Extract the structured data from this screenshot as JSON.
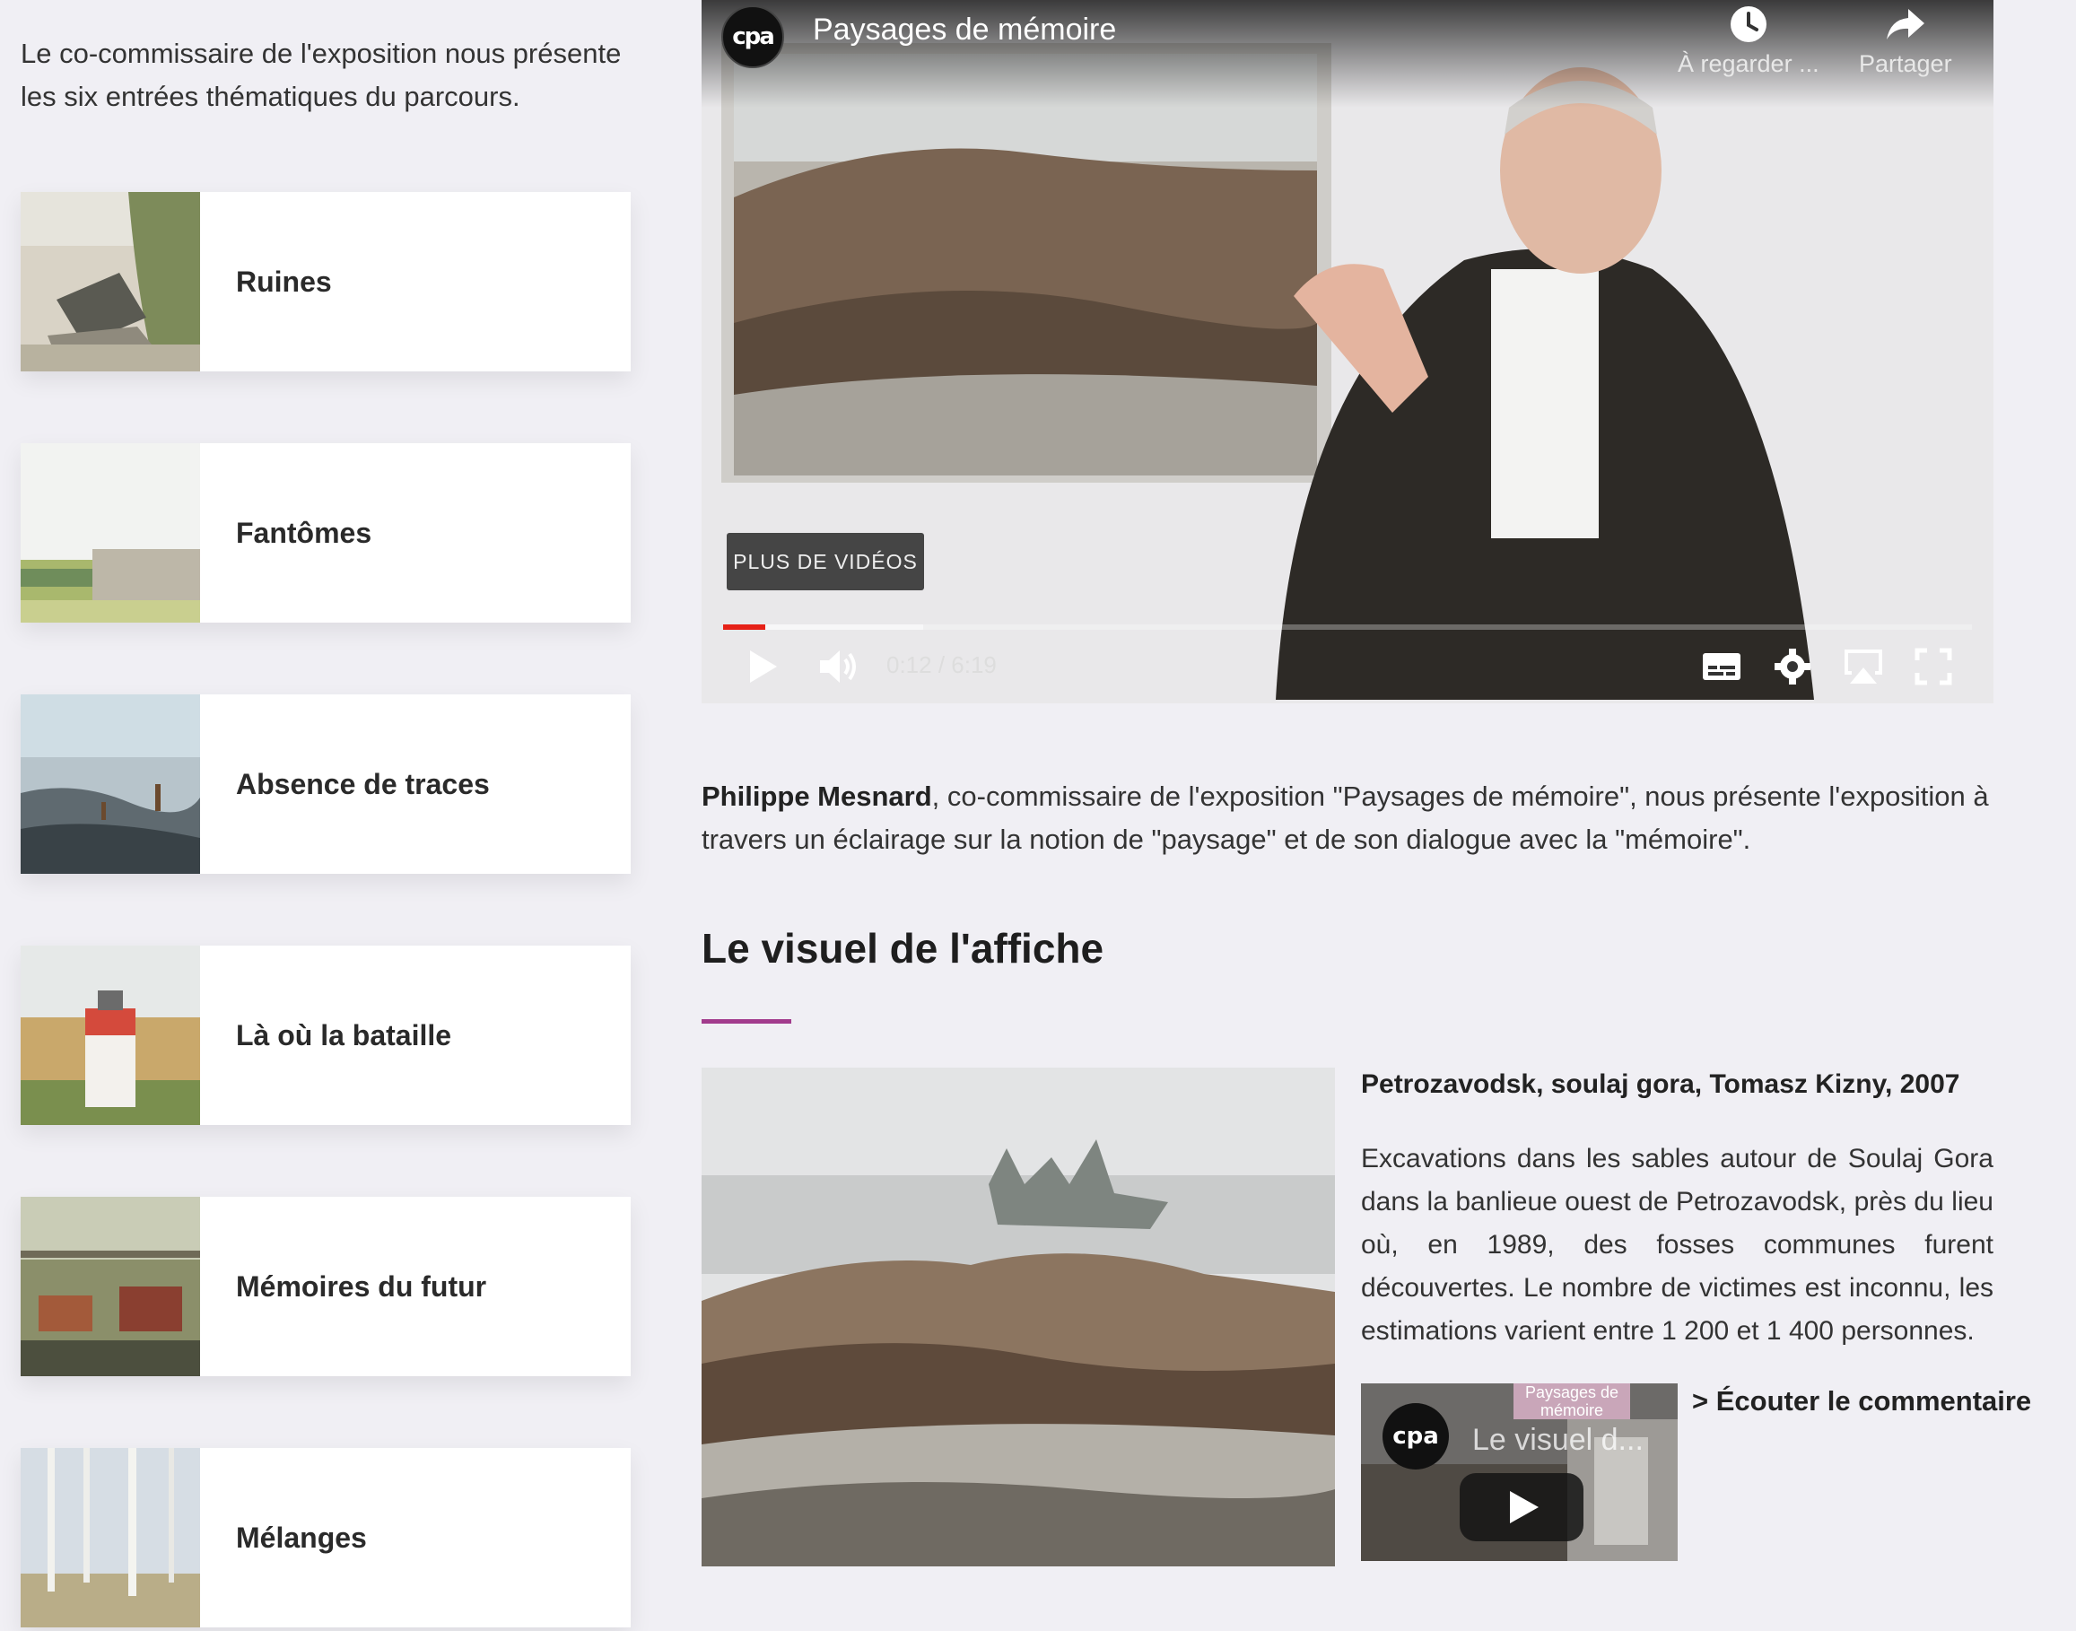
{
  "intro": "Le co-commissaire de l'exposition nous présente les six entrées thématiques du parcours.",
  "themes": [
    {
      "label": "Ruines"
    },
    {
      "label": "Fantômes"
    },
    {
      "label": "Absence de traces"
    },
    {
      "label": "Là où la bataille"
    },
    {
      "label": "Mémoires du futur"
    },
    {
      "label": "Mélanges"
    }
  ],
  "video": {
    "channel_logo": "cpa",
    "title": "Paysages de mémoire",
    "watch_later_label": "À regarder ...",
    "share_label": "Partager",
    "more_videos_label": "PLUS DE VIDÉOS",
    "time_display": "0:12 / 6:19",
    "progress": 0.034,
    "buffered": 0.16,
    "icons": [
      "clock-icon",
      "share-arrow-icon",
      "play-icon",
      "volume-icon",
      "subtitles-icon",
      "gear-icon",
      "airplay-icon",
      "fullscreen-icon"
    ]
  },
  "description": {
    "name": "Philippe Mesnard",
    "text": ", co-commissaire de l'exposition \"Paysages de mémoire\", nous présente l'exposition à travers un éclairage sur la notion de \"paysage\" et de son dialogue avec la \"mémoire\"."
  },
  "poster_section": {
    "title": "Le visuel de l'affiche",
    "accent_color": "#a23b8c",
    "caption_title": "Petrozavodsk, soulaj gora, Tomasz Kizny, 2007",
    "caption_text": "Excavations dans les sables autour de Soulaj Gora dans la banlieue ouest de Petrozavodsk, près du lieu où, en 1989, des fosses communes furent découvertes. Le nombre de victimes est inconnu, les estimations varient entre 1 200 et 1 400 personnes.",
    "mini_video_logo": "cpa",
    "mini_video_title": "Le visuel d...",
    "mini_video_badge": "Paysages de mémoire",
    "listen_label": "> Écouter le commentaire"
  }
}
